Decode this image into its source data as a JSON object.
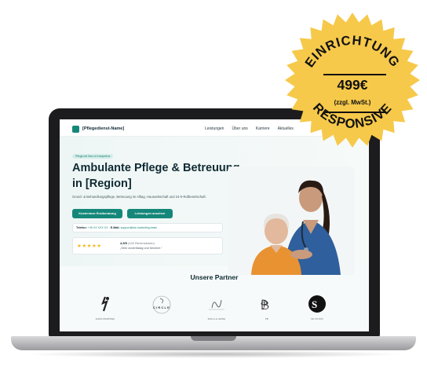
{
  "site": {
    "brand": "[Pflegedienst-Name]",
    "nav": [
      "Leistungen",
      "Über uns",
      "Karriere",
      "Aktuelles"
    ]
  },
  "hero": {
    "pill": "Pflege mit Herz & Kompetenz",
    "title": "Ambulante Pflege & Betreuung in [Region]",
    "subtitle": "Grund- & Behandlungspflege, Betreuung im Alltag, Hauswirtschaft und 24-h-Rufbereitschaft.",
    "primary_button": "Kostenlose Erstberatung",
    "secondary_button": "Leistungen ansehen",
    "contact": {
      "phone_label": "Telefon:",
      "phone_value": "+49 XX XXX XX",
      "email_label": "E-Mail:",
      "email_value": "support@ws-marketing.basin"
    },
    "reviews": {
      "stars": "★★★★★",
      "rating": "4,9/5",
      "count": "(102 Rezensionen)",
      "quote": "„Sehr zuverlässig und herzlich.“"
    }
  },
  "partners": {
    "title": "Unsere Partner",
    "items": [
      {
        "caption": "AURIN MARTINEZ"
      },
      {
        "caption": "CIRCLE"
      },
      {
        "caption": "PAULA & LEONE"
      },
      {
        "caption": "PB"
      },
      {
        "caption": "SD STUDIO"
      }
    ]
  },
  "badge": {
    "top_text": "EINRICHTUNG",
    "price": "499€",
    "tax": "(zzgl. MwSt.)",
    "bottom_text": "RESPONSIVE",
    "color": "#f6c94a"
  }
}
